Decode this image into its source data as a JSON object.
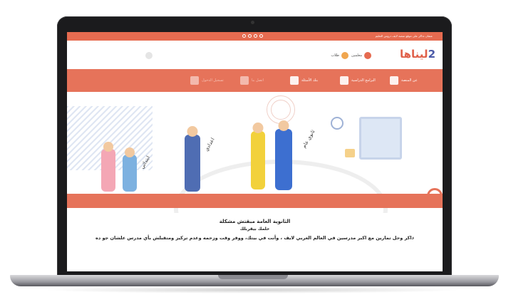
{
  "topbar": {
    "text": "عشان تذاكر على موقع منصة لايف دروس التعليم"
  },
  "header": {
    "logo_text": "ليناها",
    "logo_mark": "2",
    "roles": [
      {
        "label": "معلمين"
      },
      {
        "label": "طلاب"
      }
    ]
  },
  "nav": {
    "items": [
      {
        "label": "عن المنصة"
      },
      {
        "label": "البرامج الدراسية"
      },
      {
        "label": "بنك الأسئلة"
      },
      {
        "label": "اتصل بنا"
      },
      {
        "label": "تسجيل الدخول"
      }
    ]
  },
  "hero": {
    "labels": {
      "primary": "ابتدائي",
      "prep": "اعدادي",
      "secondary": "ثانوي عام"
    }
  },
  "copy": {
    "line1": "الثانوية العامة مبقتش مشكلة",
    "line2": "حلمك بيقربلك",
    "line3": "ذاكر وحل تمارين مع اكبر مدرسين في العالم العربي لايف ، وأنت في بيتك، ووفر وقت وزحمه وعدم تركيز ومتقبلش بأي مدرس علشان جو ده"
  },
  "colors": {
    "accent": "#e6735a",
    "brand_blue": "#4b5aa8"
  }
}
